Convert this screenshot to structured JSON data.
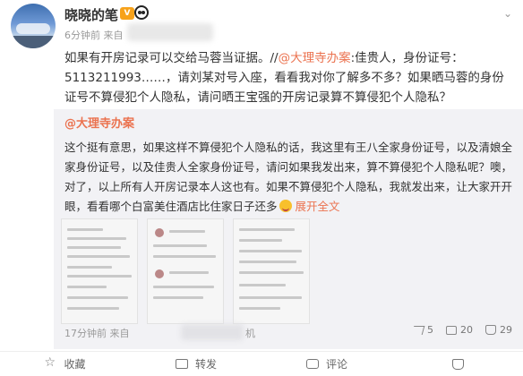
{
  "post": {
    "username": "晓晓的笔",
    "vip_badge": "V",
    "meta_time": "6分钟前 来自",
    "text_before_mention": "如果有开房记录可以交给马蓉当证据。//",
    "mention": "@大理寺办案",
    "text_after_mention": ":佳贵人，身份证号：5113211993……，请刘某对号入座，看看我对你了解多不多？如果晒马蓉的身份证号不算侵犯个人隐私，请问晒王宝强的开房记录算不算侵犯个人隐私？"
  },
  "repost": {
    "user": "@大理寺办案",
    "text": "这个挺有意思，如果这样不算侵犯个人隐私的话，我这里有王八全家身份证号，以及清娘全家身份证号，以及佳贵人全家身份证号，请问如果我发出来，算不算侵犯个人隐私呢？噢，对了，以上所有人开房记录本人这也有。如果不算侵犯个人隐私，我就发出来，让大家开开眼，看看哪个白富美住酒店比住家日子还多",
    "expand_label": "展开全文",
    "meta_time": "17分钟前 来自",
    "meta_tail": "机",
    "actions": {
      "share_count": "5",
      "comment_count": "20",
      "like_count": "29"
    }
  },
  "actions": {
    "favorite": "收藏",
    "repost": "转发",
    "comment": "评论"
  },
  "colors": {
    "accent": "#eb7350",
    "repost_bg": "#f2f2f5"
  }
}
